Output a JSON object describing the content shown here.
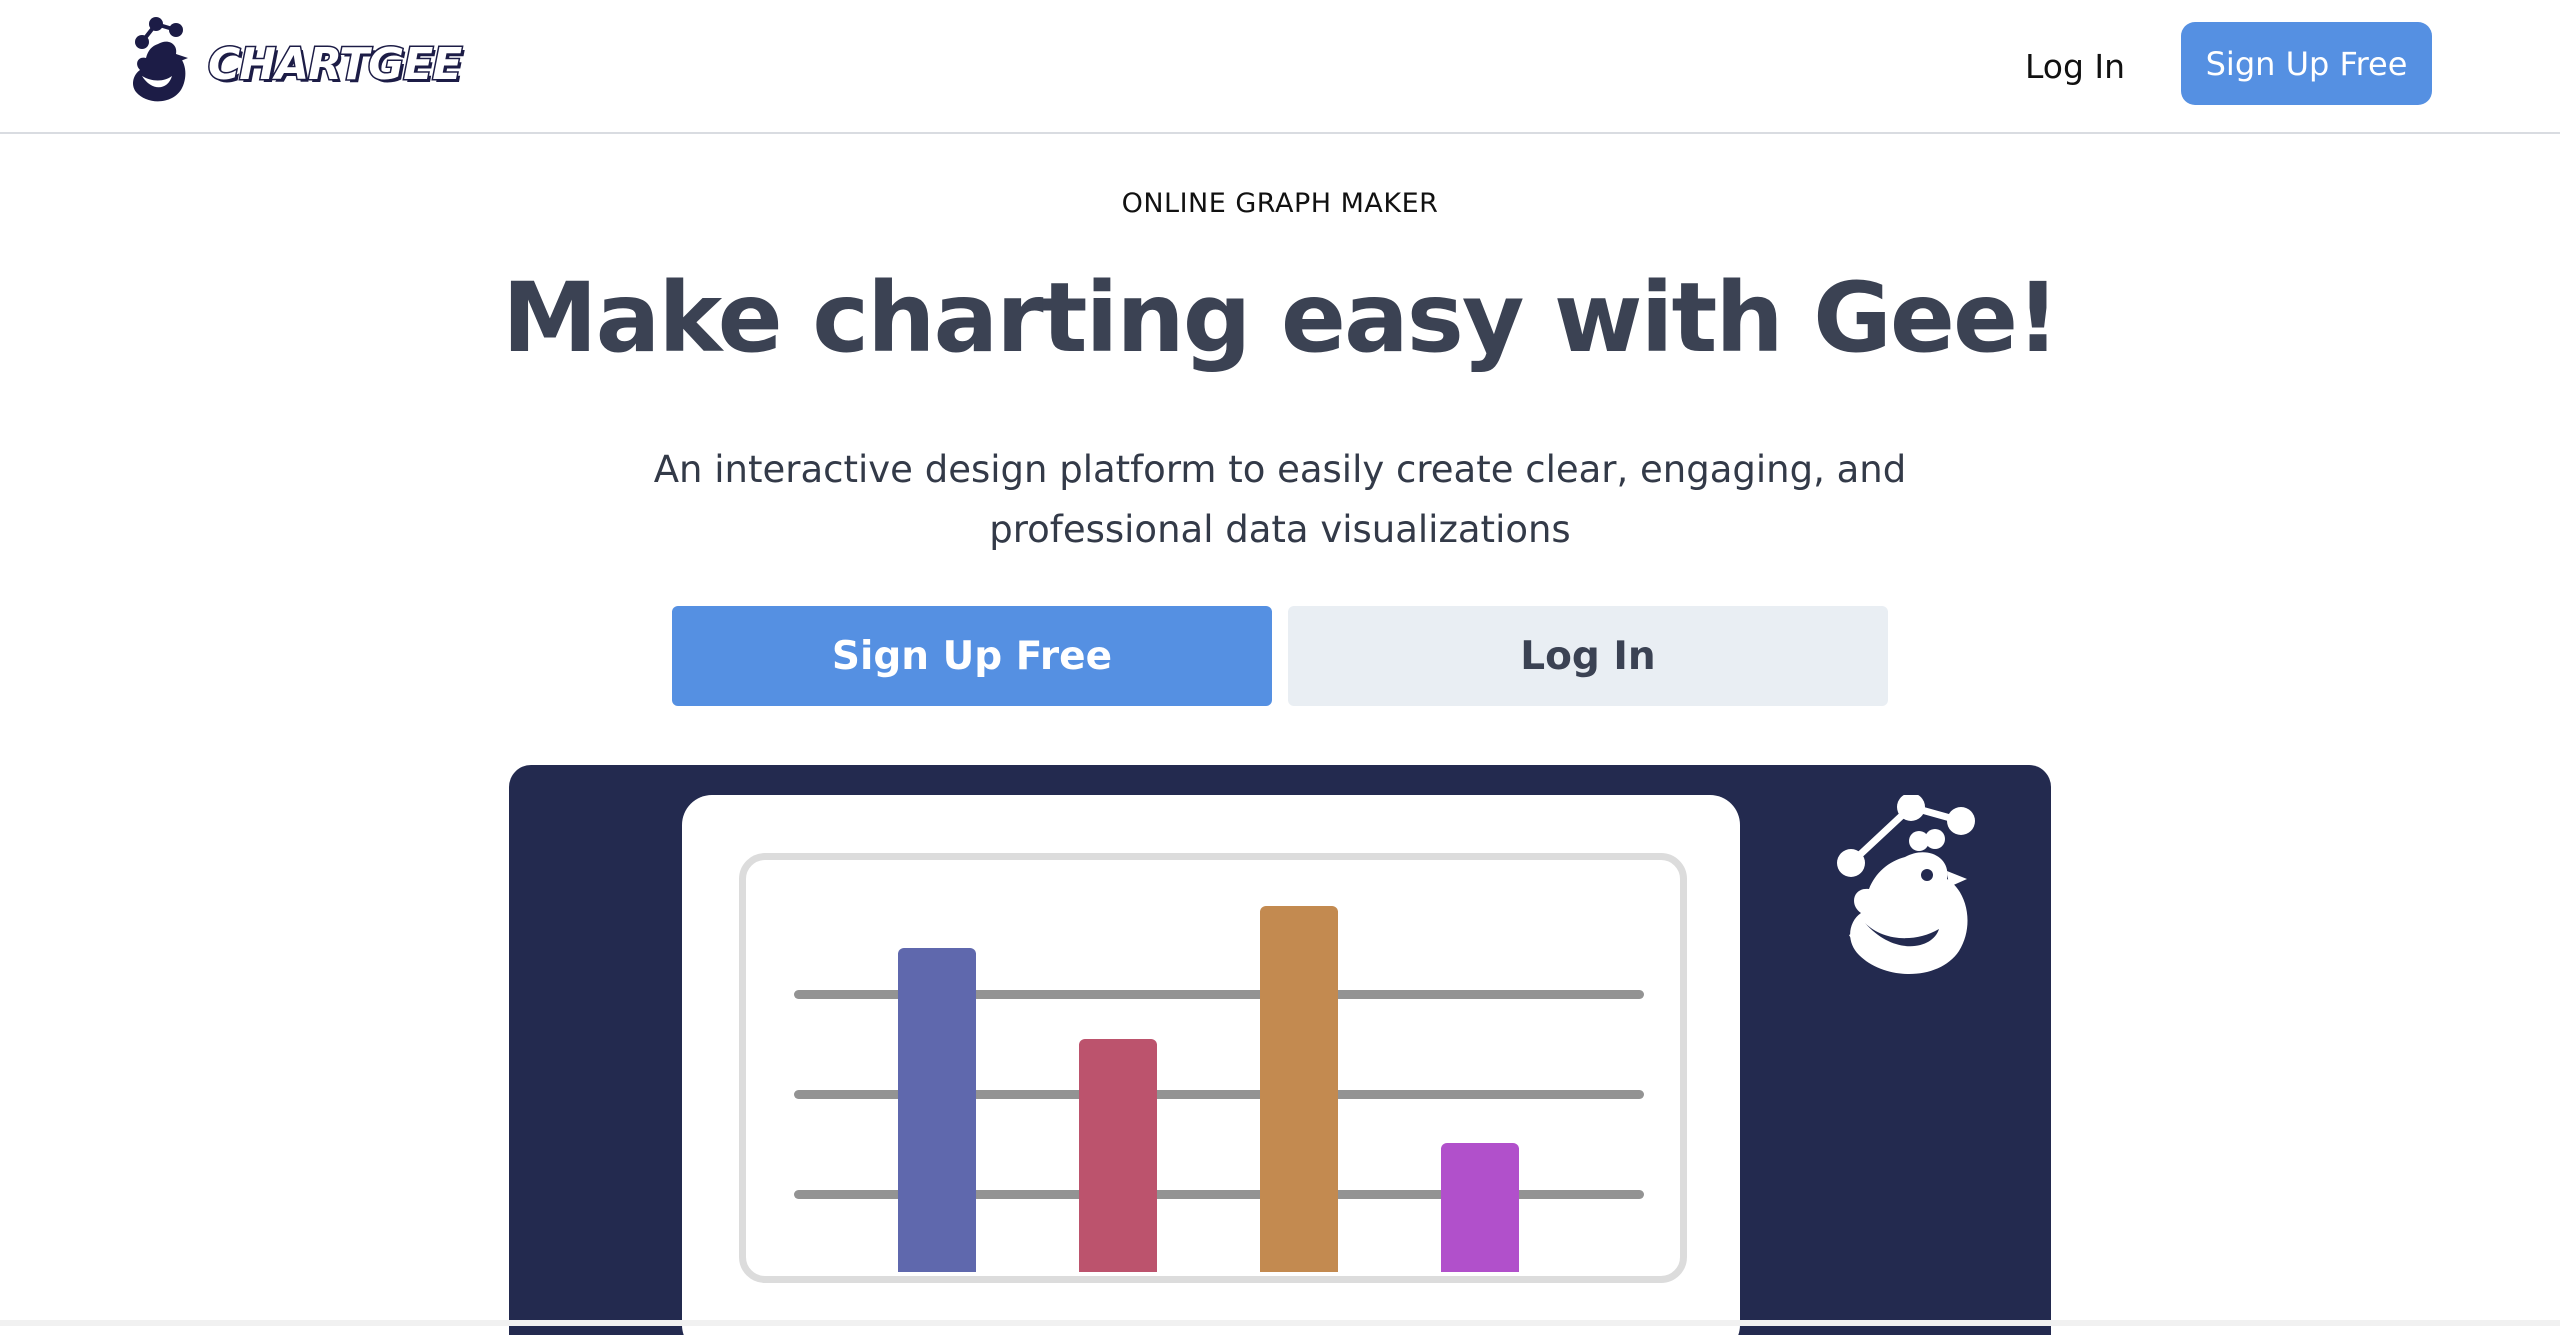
{
  "header": {
    "logo_text": "CHARTGEE",
    "login_label": "Log In",
    "signup_label": "Sign Up Free"
  },
  "hero": {
    "eyebrow": "ONLINE GRAPH MAKER",
    "headline": "Make charting easy with Gee!",
    "subline": "An interactive design platform to easily create clear, engaging, and professional data visualizations",
    "signup_label": "Sign Up Free",
    "login_label": "Log In"
  },
  "illustration": {
    "bars": [
      {
        "value": 0.78,
        "color": "#5f68ad"
      },
      {
        "value": 0.56,
        "color": "#bc536d"
      },
      {
        "value": 0.88,
        "color": "#c38a50"
      },
      {
        "value": 0.31,
        "color": "#b150cb"
      }
    ]
  },
  "colors": {
    "primary": "#5590e2",
    "secondary_button": "#e9eef3",
    "navy": "#232a4f",
    "headline": "#3b4253"
  }
}
